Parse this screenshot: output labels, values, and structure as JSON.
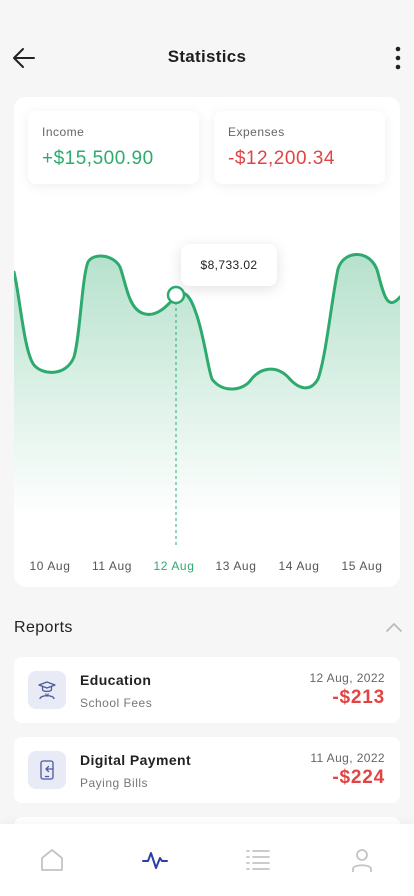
{
  "header": {
    "title": "Statistics"
  },
  "summary": {
    "income_label": "Income",
    "income_value": "+$15,500.90",
    "expenses_label": "Expenses",
    "expenses_value": "-$12,200.34"
  },
  "chart_data": {
    "type": "area",
    "title": "",
    "xlabel": "",
    "ylabel": "",
    "categories": [
      "10 Aug",
      "11 Aug",
      "12 Aug",
      "13 Aug",
      "14 Aug",
      "15 Aug"
    ],
    "selected_category": "12 Aug",
    "tooltip_value": "$8,733.02",
    "grid": false,
    "legend": "none"
  },
  "reports": {
    "title": "Reports",
    "items": [
      {
        "name": "Education",
        "subtitle": "School Fees",
        "date": "12 Aug, 2022",
        "amount": "-$213",
        "icon": "graduate-icon"
      },
      {
        "name": "Digital Payment",
        "subtitle": "Paying Bills",
        "date": "11 Aug, 2022",
        "amount": "-$224",
        "icon": "mobile-payment-icon"
      }
    ]
  },
  "nav": {
    "items": [
      "home-icon",
      "activity-icon",
      "list-icon",
      "profile-icon"
    ],
    "active": "activity-icon"
  },
  "colors": {
    "income": "#2eaa6f",
    "expense": "#e04444",
    "active_nav": "#2b3ea8",
    "icon_box": "#e8ebf5"
  }
}
